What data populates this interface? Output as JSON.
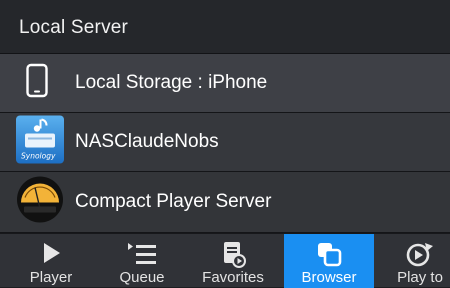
{
  "header": {
    "title": "Local Server"
  },
  "servers": [
    {
      "label": "Local Storage : iPhone",
      "icon": "phone-icon"
    },
    {
      "label": "NASClaudeNobs",
      "icon": "synology-nas-icon",
      "badge": "Synology"
    },
    {
      "label": "Compact Player Server",
      "icon": "vu-meter-icon"
    }
  ],
  "tabs": [
    {
      "label": "Player",
      "icon": "play-icon"
    },
    {
      "label": "Queue",
      "icon": "queue-list-icon"
    },
    {
      "label": "Favorites",
      "icon": "favorites-icon"
    },
    {
      "label": "Browser",
      "icon": "browser-icon",
      "active": true
    },
    {
      "label": "Play to",
      "icon": "play-to-icon"
    }
  ],
  "colors": {
    "accent": "#1a8ff2",
    "header_bg": "#25272b",
    "tabbar_bg": "#303237"
  }
}
